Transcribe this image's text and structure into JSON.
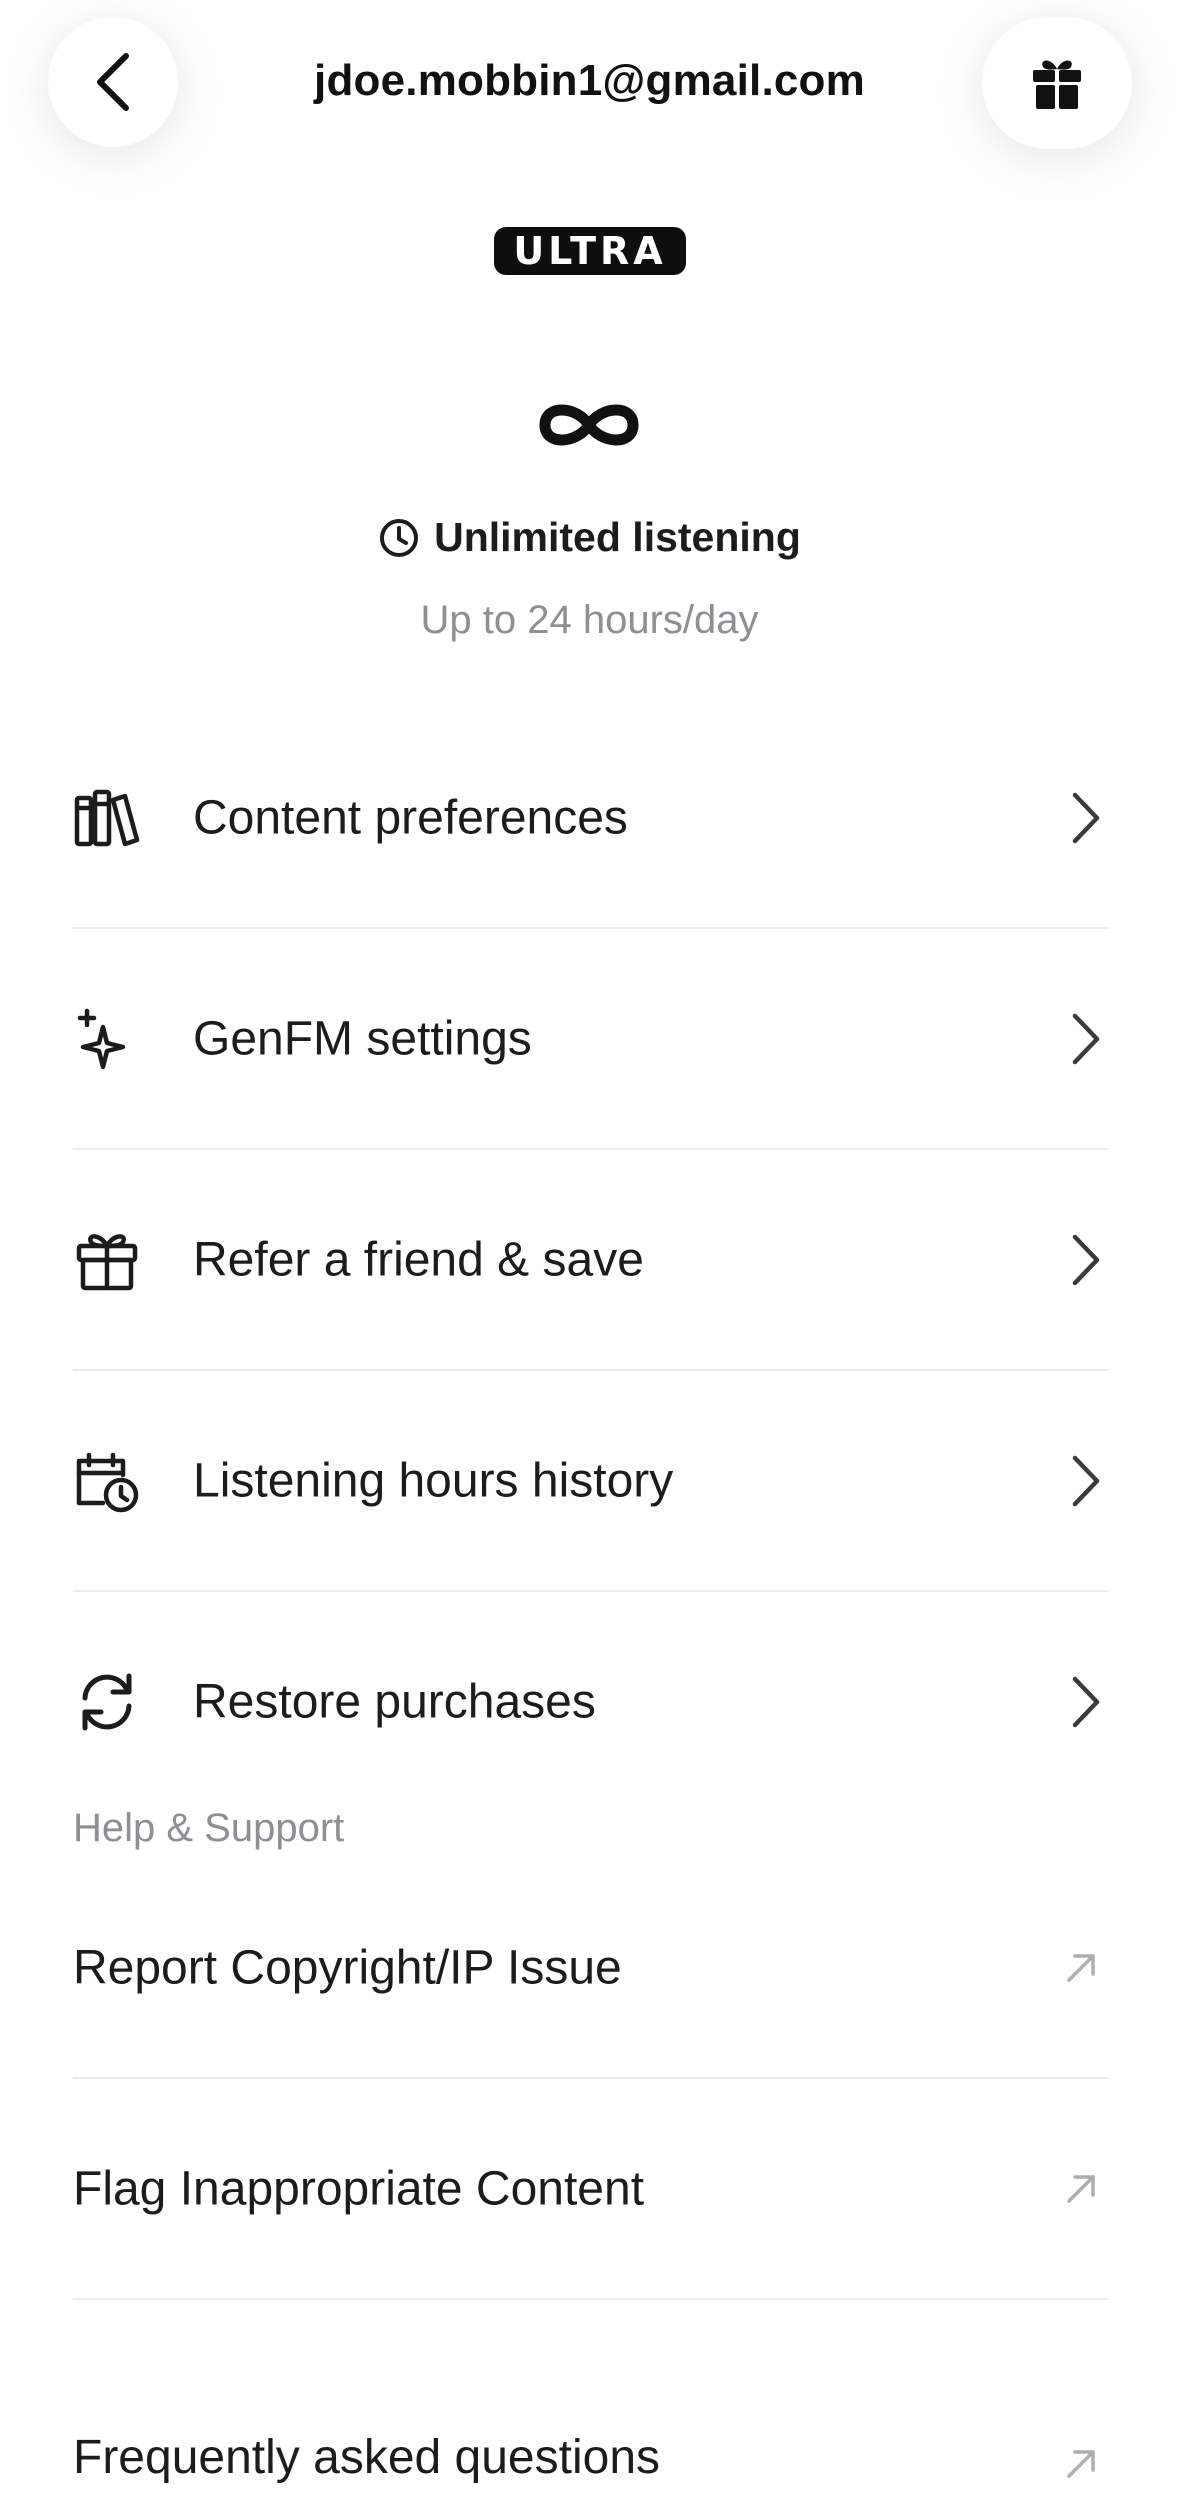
{
  "header": {
    "title": "jdoe.mobbin1@gmail.com",
    "back_icon": "chevron-left-icon",
    "gift_icon": "gift-icon"
  },
  "plan": {
    "badge": "ULTRA",
    "icon": "infinity-icon",
    "title": "Unlimited listening",
    "subtitle": "Up to 24 hours/day"
  },
  "menu": {
    "items": [
      {
        "label": "Content preferences",
        "icon": "library-books-icon"
      },
      {
        "label": "GenFM settings",
        "icon": "sparkles-icon"
      },
      {
        "label": "Refer a friend & save",
        "icon": "gift-icon"
      },
      {
        "label": "Listening hours history",
        "icon": "calendar-clock-icon"
      },
      {
        "label": "Restore purchases",
        "icon": "refresh-icon"
      }
    ]
  },
  "support": {
    "section_label": "Help & Support",
    "items": [
      {
        "label": "Report Copyright/IP Issue",
        "icon": "external-arrow-icon"
      },
      {
        "label": "Flag Inappropriate Content",
        "icon": "external-arrow-icon"
      },
      {
        "label": "Frequently asked questions",
        "icon": "external-arrow-icon"
      }
    ]
  },
  "colors": {
    "text_primary": "#1c1c1e",
    "text_secondary": "#8e8e93",
    "divider": "#ececee",
    "badge_bg": "#0e0e0e",
    "background": "#ffffff"
  }
}
